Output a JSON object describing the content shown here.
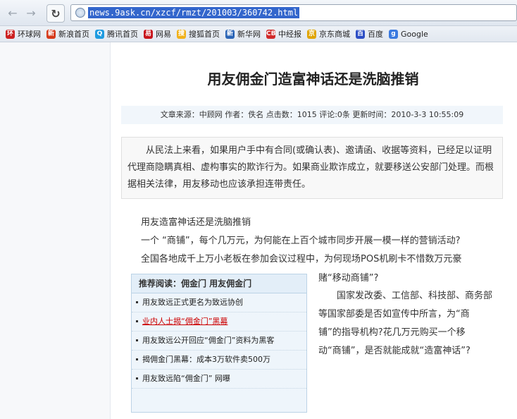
{
  "browser": {
    "url": "news.9ask.cn/xzcf/rmzt/201003/360742.html"
  },
  "bookmarks": [
    {
      "label": "环球网",
      "icon": "huanqiu-icon",
      "color": "#cc2222",
      "glyph": "环"
    },
    {
      "label": "新浪首页",
      "icon": "sina-icon",
      "color": "#d63a1a",
      "glyph": "新"
    },
    {
      "label": "腾讯首页",
      "icon": "qq-icon",
      "color": "#1e9be0",
      "glyph": "Q"
    },
    {
      "label": "网易",
      "icon": "netease-icon",
      "color": "#c8161d",
      "glyph": "易"
    },
    {
      "label": "搜狐首页",
      "icon": "sohu-icon",
      "color": "#f1b11a",
      "glyph": "搜"
    },
    {
      "label": "新华网",
      "icon": "xinhua-icon",
      "color": "#2b65b6",
      "glyph": "新"
    },
    {
      "label": "中经报",
      "icon": "cb-icon",
      "color": "#d12a2a",
      "glyph": "CB"
    },
    {
      "label": "京东商城",
      "icon": "jd-icon",
      "color": "#e0a400",
      "glyph": "京"
    },
    {
      "label": "百度",
      "icon": "baidu-icon",
      "color": "#2d4fc5",
      "glyph": "百"
    },
    {
      "label": "Google",
      "icon": "google-icon",
      "color": "#3a7ae0",
      "glyph": "g"
    }
  ],
  "article": {
    "title": "用友佣金门造富神话还是洗脑推销",
    "meta": "文章来源：中顾网  作者：佚名  点击数：1015  评论:0条  更新时间：2010-3-3 10:55:09",
    "summary": "从民法上来看，如果用户手中有合同(或确认表)、邀请函、收据等资料，已经足以证明代理商隐瞒真相、虚构事实的欺诈行为。如果商业欺诈成立，就要移送公安部门处理。而根据相关法律，用友移动也应该承担连带责任。",
    "paragraphs": [
      "用友造富神话还是洗脑推销",
      "一个 “商铺”，每个几万元，为何能在上百个城市同步开展一模一样的营销活动?",
      "全国各地成千上万小老板在参加会议过程中，为何现场POS机刷卡不惜数万元豪"
    ],
    "side_lines": [
      "赌“移动商铺”?",
      "国家发改委、工信部、科技部、商务部",
      "等国家部委是否如宣传中所言，为“商",
      "铺”的指导机构?花几万元购买一个移",
      "动“商铺”，是否就能成就“造富神话”?"
    ]
  },
  "recommend": {
    "heading": "推荐阅读：佣金门 用友佣金门",
    "items": [
      "用友致远正式更名为致远协创",
      "业内人士揭“佣金门”黑幕",
      "用友致远公开回应“佣金门”资料为黑客",
      "揭佣金门黑幕：成本3万软件卖500万",
      "用友致远陷“佣金门” 网曝"
    ]
  }
}
